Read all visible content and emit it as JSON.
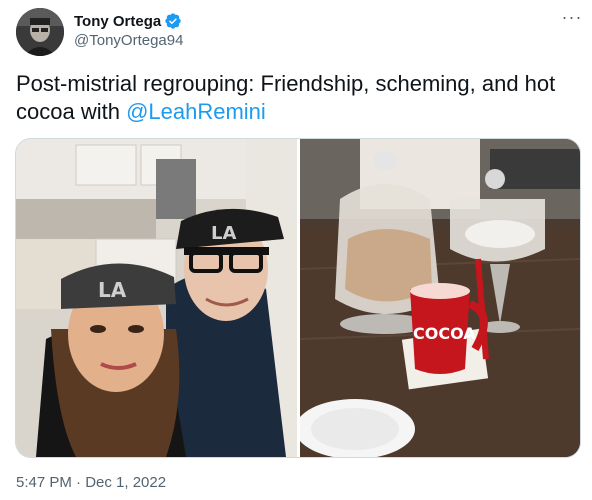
{
  "tweet": {
    "author": {
      "display_name": "Tony Ortega",
      "handle": "@TonyOrtega94",
      "verified": true,
      "avatar_icon": "user-avatar-photo"
    },
    "text_before_mention": "Post-mistrial regrouping: Friendship, scheming, and hot cocoa with ",
    "mention": "@LeahRemini",
    "more_icon": "more-options-icon",
    "media": [
      {
        "kind": "photo",
        "description_icon": "selfie-photo",
        "cap_logo": "LA"
      },
      {
        "kind": "photo",
        "description_icon": "cocoa-table-photo",
        "mug_text": "COCOA"
      }
    ],
    "timestamp": "5:47 PM · Dec 1, 2022"
  },
  "colors": {
    "text_primary": "#0f1419",
    "text_secondary": "#536471",
    "link_blue": "#1d9bf0",
    "verified_blue": "#1d9bf0",
    "border": "#cfd9de"
  }
}
